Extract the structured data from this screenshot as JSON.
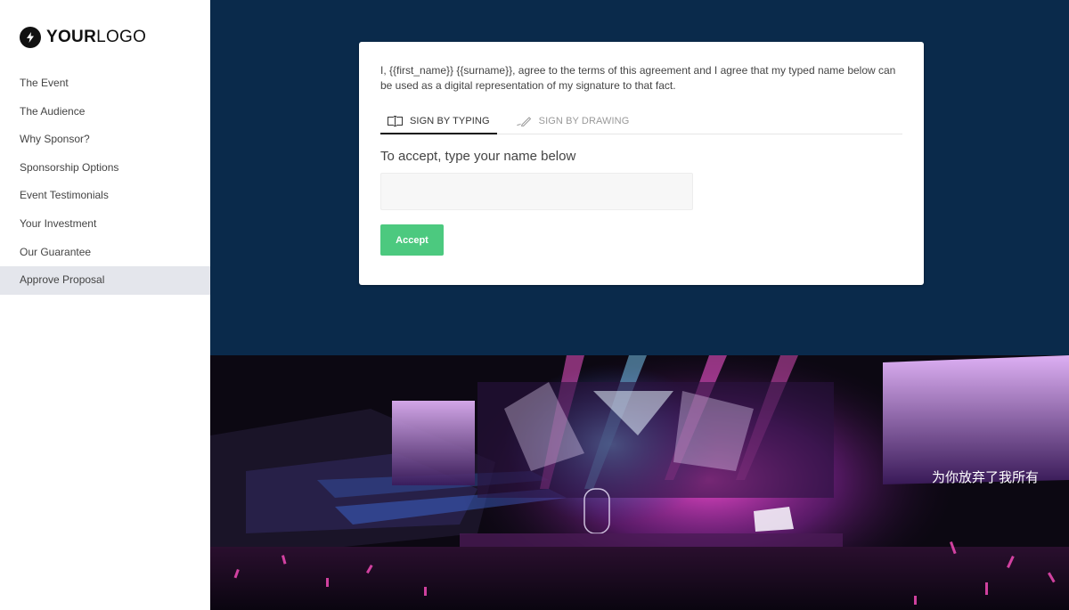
{
  "logo": {
    "bold": "YOUR",
    "light": "LOGO",
    "icon": "lightning-bolt-icon"
  },
  "sidebar": {
    "items": [
      {
        "label": "The Event"
      },
      {
        "label": "The Audience"
      },
      {
        "label": "Why Sponsor?"
      },
      {
        "label": "Sponsorship Options"
      },
      {
        "label": "Event Testimonials"
      },
      {
        "label": "Your Investment"
      },
      {
        "label": "Our Guarantee"
      },
      {
        "label": "Approve Proposal",
        "active": true
      }
    ]
  },
  "signature": {
    "agreement_text": "I, {{first_name}} {{surname}}, agree to the terms of this agreement and I agree that my typed name below can be used as a digital representation of my signature to that fact.",
    "tabs": [
      {
        "label": "SIGN BY TYPING",
        "icon": "text-cursor-icon",
        "active": true
      },
      {
        "label": "SIGN BY DRAWING",
        "icon": "pen-icon",
        "active": false
      }
    ],
    "prompt": "To accept, type your name below",
    "name_input": {
      "value": "",
      "placeholder": ""
    },
    "accept_label": "Accept"
  },
  "photo": {
    "description": "Concert arena with stage lights and crowd",
    "screen_caption": "为你放弃了我所有"
  },
  "colors": {
    "navy": "#0a2a4b",
    "accept_green": "#4cc97f",
    "active_nav_bg": "#e4e6ec"
  }
}
